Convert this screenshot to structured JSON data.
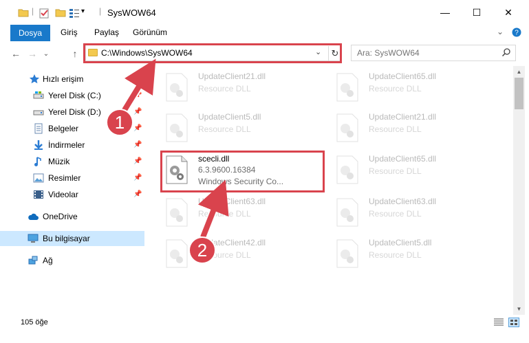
{
  "window": {
    "title": "SysWOW64",
    "minimize_symbol": "—",
    "maximize_symbol": "☐",
    "close_symbol": "✕"
  },
  "quick_access": {
    "separator": "|",
    "dropdown": "▾",
    "divider": "|"
  },
  "ribbon": {
    "file_tab": "Dosya",
    "tabs": [
      "Giriş",
      "Paylaş",
      "Görünüm"
    ],
    "expand": "⌄",
    "help": "?"
  },
  "navigation": {
    "back": "←",
    "forward": "→",
    "recent": "⌄",
    "up": "↑",
    "address": "C:\\Windows\\SysWOW64",
    "address_dropdown": "⌄",
    "refresh": "↻",
    "search_placeholder": "Ara: SysWOW64"
  },
  "sidebar": {
    "items": [
      {
        "label": "Hızlı erişim",
        "icon": "star-icon",
        "pinned": false
      },
      {
        "label": "Yerel Disk (C:)",
        "icon": "drive-icon",
        "pinned": true
      },
      {
        "label": "Yerel Disk (D:)",
        "icon": "drive-icon",
        "pinned": true
      },
      {
        "label": "Belgeler",
        "icon": "documents-icon",
        "pinned": true
      },
      {
        "label": "İndirmeler",
        "icon": "download-icon",
        "pinned": true
      },
      {
        "label": "Müzik",
        "icon": "music-icon",
        "pinned": true
      },
      {
        "label": "Resimler",
        "icon": "pictures-icon",
        "pinned": true
      },
      {
        "label": "Videolar",
        "icon": "videos-icon",
        "pinned": true
      },
      {
        "label": "OneDrive",
        "icon": "cloud-icon",
        "pinned": false
      },
      {
        "label": "Bu bilgisayar",
        "icon": "computer-icon",
        "pinned": false,
        "selected": true
      },
      {
        "label": "Ağ",
        "icon": "network-icon",
        "pinned": false
      }
    ]
  },
  "files": {
    "left": [
      {
        "name": "UpdateClient21.dll",
        "type": "Resource DLL"
      },
      {
        "name": "UpdateClient5.dll",
        "type": "Resource DLL"
      },
      {
        "name": "scecli.dll",
        "version": "6.3.9600.16384",
        "description": "Windows Security Co..."
      },
      {
        "name": "UpdateClient63.dll",
        "type": "Resource DLL"
      },
      {
        "name": "UpdateClient42.dll",
        "type": "Resource DLL"
      }
    ],
    "right": [
      {
        "name": "UpdateClient65.dll",
        "type": "Resource DLL"
      },
      {
        "name": "UpdateClient21.dll",
        "type": "Resource DLL"
      },
      {
        "name": "UpdateClient65.dll",
        "type": "Resource DLL"
      },
      {
        "name": "UpdateClient63.dll",
        "type": "Resource DLL"
      },
      {
        "name": "UpdateClient5.dll",
        "type": "Resource DLL"
      }
    ]
  },
  "status": {
    "item_count": "105 öğe"
  },
  "callouts": [
    "1",
    "2"
  ],
  "colors": {
    "accent": "#1979ca",
    "highlight": "#d9434d",
    "selected": "#cce8ff",
    "folder": "#f3c94f"
  }
}
